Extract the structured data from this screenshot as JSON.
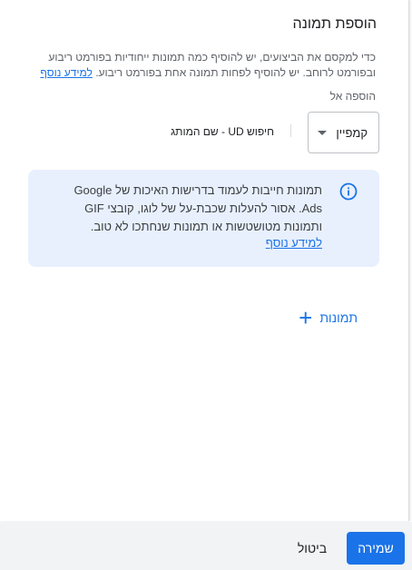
{
  "dialog": {
    "title": "הוספת תמונה",
    "description": "כדי למקסם את הביצועים, יש להוסיף כמה תמונות ייחודיות בפורמט ריבוע ובפורמט לרוחב. יש להוסיף לפחות תמונה אחת בפורמט ריבוע.",
    "learn_more": "למידע נוסף"
  },
  "add_to": {
    "label": "הוספה אל",
    "dropdown_value": "קמפיין",
    "search_text": "חיפוש UD - שם המותג"
  },
  "info_box": {
    "text": "תמונות חייבות לעמוד בדרישות האיכות של Google Ads. אסור להעלות שכבת-על של לוגו, קובצי GIF ותמונות מטושטשות או תמונות שנחתכו לא טוב.",
    "link": "למידע נוסף",
    "icon": "info-icon"
  },
  "add_images": {
    "label": "תמונות",
    "icon": "plus-icon"
  },
  "footer": {
    "save_label": "שמירה",
    "cancel_label": "ביטול"
  },
  "colors": {
    "accent": "#1a73e8",
    "info_bg": "#e8f0fe",
    "footer_bg": "#f1f3f4"
  }
}
